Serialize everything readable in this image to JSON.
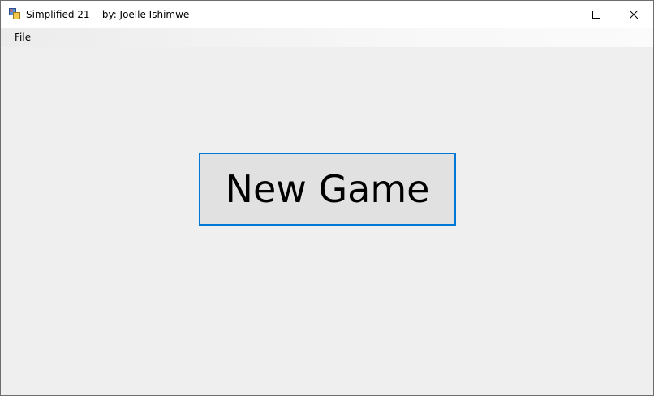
{
  "window": {
    "title": "Simplified 21",
    "author": "by: Joelle Ishimwe"
  },
  "menu": {
    "items": [
      {
        "label": "File"
      }
    ]
  },
  "main": {
    "new_game_label": "New Game"
  },
  "icons": {
    "app": "app-icon",
    "minimize": "minimize-icon",
    "maximize": "maximize-icon",
    "close": "close-icon"
  },
  "colors": {
    "background": "#efefef",
    "button_face": "#e1e1e1",
    "focus_border": "#0078d7"
  }
}
